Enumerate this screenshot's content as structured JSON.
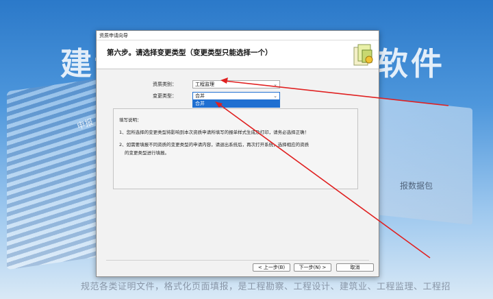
{
  "background": {
    "title_left": "建设",
    "title_right": "软件",
    "side_label": "报数据包",
    "shenbao": "申报",
    "bottom_text": "规范各类证明文件，格式化页面填报，是工程勘察、工程设计、建筑业、工程监理、工程招"
  },
  "window": {
    "title": "资质申请向导",
    "step_title": "第六步。请选择变更类型（变更类型只能选择一个）"
  },
  "form": {
    "category_label": "资质类别：",
    "category_value": "工程监理",
    "change_label": "变更类型：",
    "change_value": "合并",
    "dropdown_option": "合并"
  },
  "notes": {
    "heading": "填写说明：",
    "item1": "1、您所选择的变更类型将影响到本次资质申请所填写的报单样式生成及打印，请务必选择正确！",
    "item2_line1": "2、如需要填报不同资质的变更类型的申请内容，请退出系统后，再次打开系统，选择相应的资质",
    "item2_line2": "的变更类型进行填报。"
  },
  "buttons": {
    "prev": "< 上一步(B)",
    "next": "下一步(N) >",
    "cancel": "取消"
  },
  "colors": {
    "accent": "#1f6fd1",
    "arrow": "#e02020"
  }
}
